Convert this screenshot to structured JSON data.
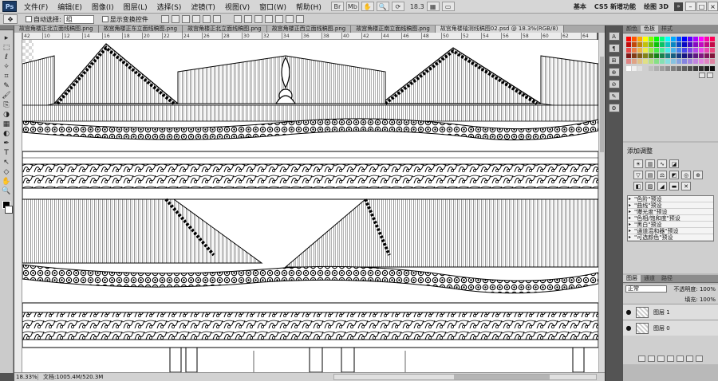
{
  "app": {
    "logo": "Ps"
  },
  "menu": [
    "文件(F)",
    "编辑(E)",
    "图像(I)",
    "图层(L)",
    "选择(S)",
    "滤镜(T)",
    "视图(V)",
    "窗口(W)",
    "帮助(H)"
  ],
  "menubar_tools": {
    "zoom_value": "18.3"
  },
  "workspaces": [
    "基本",
    "CS5 新增功能",
    "绘图 3D"
  ],
  "workspace_ext": "»",
  "window_controls": [
    "–",
    "□",
    "×"
  ],
  "options": {
    "auto_select_label": "自动选择:",
    "auto_select_value": "组",
    "show_transform_label": "显示变换控件"
  },
  "tools": [
    "▸",
    "⬚",
    "ℓ",
    "✧",
    "⌗",
    "✎",
    "🖌",
    "⎘",
    "◑",
    "▦",
    "◐",
    "✒",
    "T",
    "↖",
    "◇",
    "✋",
    "🔍"
  ],
  "tabs": [
    "故宫角楼正北立面线稿图.png",
    "故宫角楼正东立面线稿图.png",
    "故宫角楼正北立面线稿图.png",
    "故宫角楼正西立面线稿图.png",
    "故宫角楼正南立面线稿图.png",
    "故宫角楼轴测线稿图02.psd @ 18.3%(RGB/8)"
  ],
  "ruler": [
    "42",
    "10",
    "12",
    "14",
    "16",
    "18",
    "20",
    "22",
    "24",
    "26",
    "28",
    "30",
    "32",
    "34",
    "36",
    "38",
    "40",
    "42",
    "44",
    "46",
    "48",
    "50",
    "52",
    "54",
    "56",
    "58",
    "60",
    "62",
    "64"
  ],
  "status": {
    "zoom": "18.33%",
    "doc": "文档:1005.4M/520.3M"
  },
  "dock": [
    "A",
    "¶",
    "⊞",
    "⊕",
    "⊘",
    "✎",
    "⚙"
  ],
  "swatches_panel": {
    "tabs": [
      "颜色",
      "色板",
      "样式"
    ]
  },
  "adjustments": {
    "title": "添加调整",
    "presets": [
      "\"色阶\"预设",
      "\"曲线\"预设",
      "\"曝光度\"预设",
      "\"色相/饱和度\"预设",
      "\"黑白\"预设",
      "\"通道混和器\"预设",
      "\"可选颜色\"预设"
    ]
  },
  "layers_panel": {
    "tabs": [
      "图层",
      "通道",
      "路径"
    ],
    "blend_mode": "正常",
    "opacity_label": "不透明度: 100%",
    "fill_label": "填充: 100%",
    "layers": [
      {
        "name": "图层 1",
        "visible_mark": "●",
        "selected": false
      },
      {
        "name": "图层 0",
        "visible_mark": "●",
        "selected": false
      }
    ]
  },
  "colors": {
    "ui_dark": "#535353",
    "panel": "#cfcfcf"
  }
}
